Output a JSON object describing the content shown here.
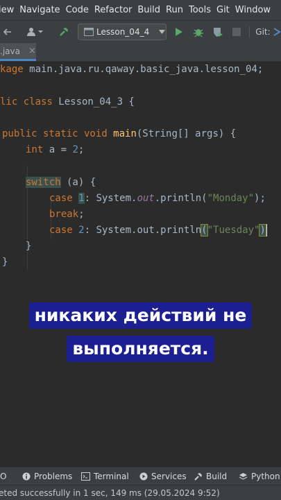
{
  "menu": [
    "iew",
    "Navigate",
    "Code",
    "Refactor",
    "Build",
    "Run",
    "Tools",
    "Git",
    "Window"
  ],
  "toolbar": {
    "run_config": "Lesson_04_4",
    "git_label": "Git:"
  },
  "tab": {
    "label": ".java",
    "close": "×"
  },
  "code": {
    "l1_kw": "kage",
    "l1_rest": " main.java.ru.qaway.basic_java.lesson_04;",
    "l2_kw": "lic class",
    "l2_rest": " Lesson_04_3 {",
    "l3_kw": "public static void",
    "l3_fn": "main",
    "l3_rest": "(String[] args) {",
    "l4_kw": "int",
    "l4_mid": " a = ",
    "l4_num": "2",
    "l4_end": ";",
    "l5_kw": "switch",
    "l5_rest": " (a) {",
    "l6_kw": "case",
    "l6_num": "1",
    "l6_mid": ": System.",
    "l6_it": "out",
    "l6_mid2": ".println(",
    "l6_str": "\"Monday\"",
    "l6_end": ");",
    "l7_kw": "break",
    "l7_end": ";",
    "l8_kw": "case",
    "l8_num": "2",
    "l8_mid": ": System.out.println",
    "l8_open": "(",
    "l8_str": "\"Tuesday\"",
    "l8_close": ")",
    "l9": "}",
    "l10": "}"
  },
  "subtitle": {
    "line1": "никаких действий не",
    "line2": "выполняется."
  },
  "toolwindows": {
    "todo": "O",
    "problems": "Problems",
    "terminal": "Terminal",
    "services": "Services",
    "build": "Build",
    "python": "Python P"
  },
  "status": {
    "text": "eted successfully in 1 sec, 149 ms (29.05.2024 9:52)"
  },
  "colors": {
    "keyword": "#cc7832",
    "number": "#6897bb",
    "string": "#6a8759",
    "method": "#ffc66d",
    "subtitle_bg": "#1b1f8f"
  }
}
